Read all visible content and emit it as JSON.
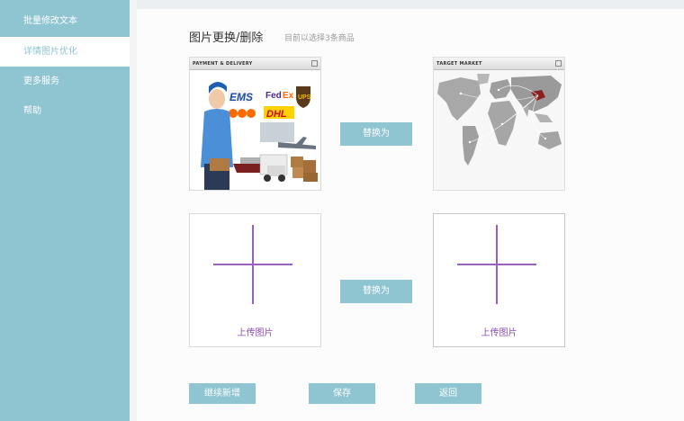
{
  "sidebar": {
    "items": [
      {
        "label": "批量修改文本"
      },
      {
        "label": "详情图片优化"
      },
      {
        "label": "更多服务"
      },
      {
        "label": "帮助"
      }
    ]
  },
  "header": {
    "title": "图片更换/删除",
    "subtitle": "目前以选择3条商品"
  },
  "rows": [
    {
      "left_image": {
        "header_text": "PAYMENT & DELIVERY"
      },
      "replace_label": "替换为",
      "right_image": {
        "header_text": "TARGET MARKET"
      }
    },
    {
      "left_upload": {
        "label": "上传图片"
      },
      "replace_label": "替换为",
      "right_upload": {
        "label": "上传图片"
      }
    }
  ],
  "actions": {
    "continue_label": "继续新增",
    "save_label": "保存",
    "back_label": "返回"
  },
  "colors": {
    "accent": "#8fc4d1",
    "upload_plus": "#9b5fc0"
  }
}
